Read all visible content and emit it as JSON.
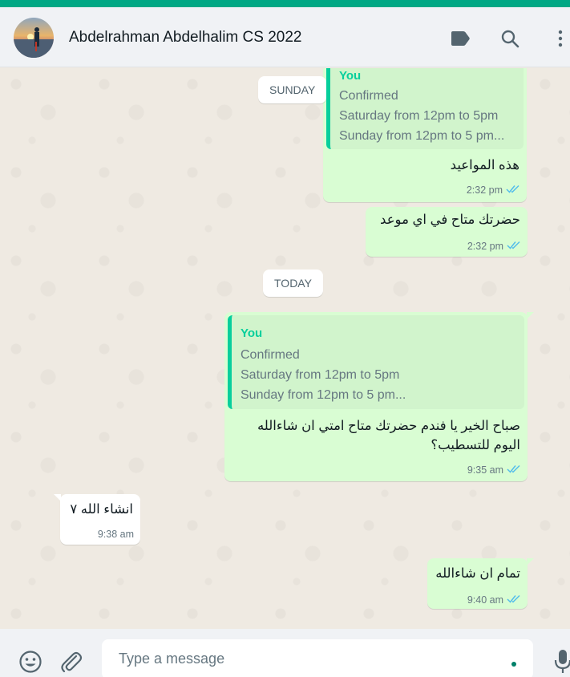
{
  "colors": {
    "accent": "#00a884",
    "outgoing_bubble": "#d9fdd3",
    "incoming_bubble": "#ffffff",
    "quote_author": "#06cf9c",
    "read_ticks": "#53bdeb",
    "chat_background": "#efeae2"
  },
  "header": {
    "contact_name": "Abdelrahman Abdelhalim CS 2022",
    "icons": [
      "label-icon",
      "search-icon",
      "menu-icon"
    ]
  },
  "separators": {
    "sunday": "SUNDAY",
    "today": "TODAY"
  },
  "messages": [
    {
      "direction": "out",
      "quote": {
        "author": "You",
        "lines": [
          "Confirmed",
          "Saturday from 12pm to 5pm",
          "Sunday from 12pm to 5 pm..."
        ]
      },
      "text": "هذه المواعيد",
      "time": "2:32 pm",
      "status": "read"
    },
    {
      "direction": "out",
      "text": "حضرتك متاح في اي موعد",
      "time": "2:32 pm",
      "status": "read"
    },
    {
      "direction": "out",
      "quote": {
        "author": "You",
        "lines": [
          "Confirmed",
          "Saturday from 12pm to 5pm",
          "Sunday from 12pm to 5 pm..."
        ]
      },
      "text_lines": [
        "صباح الخير يا فندم حضرتك متاح امتي ان شاءالله",
        "اليوم للتسطيب؟"
      ],
      "time": "9:35 am",
      "status": "read"
    },
    {
      "direction": "in",
      "text": "انشاء الله ٧",
      "time": "9:38 am"
    },
    {
      "direction": "out",
      "text": "تمام ان شاءالله",
      "time": "9:40 am",
      "status": "read"
    }
  ],
  "composer": {
    "placeholder": "Type a message",
    "icons": [
      "emoji-icon",
      "attach-icon",
      "microphone-icon"
    ]
  }
}
